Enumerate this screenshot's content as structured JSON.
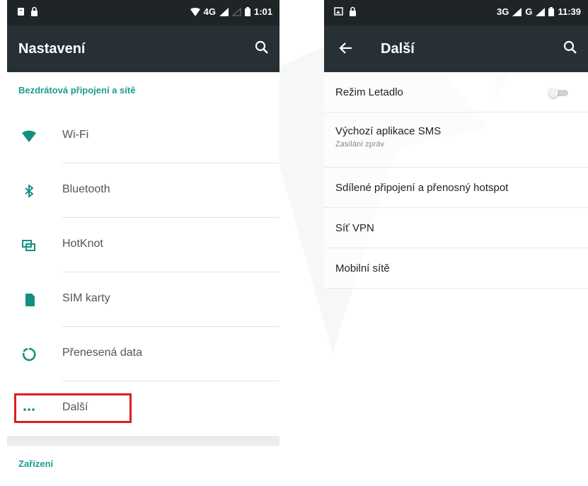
{
  "left_screen": {
    "status_bar": {
      "network": "4G",
      "time": "1:01"
    },
    "app_bar": {
      "title": "Nastavení"
    },
    "sections": [
      {
        "header": "Bezdrátová připojení a sítě",
        "items": [
          {
            "label": "Wi-Fi",
            "icon": "wifi-icon"
          },
          {
            "label": "Bluetooth",
            "icon": "bluetooth-icon"
          },
          {
            "label": "HotKnot",
            "icon": "hotknot-icon"
          },
          {
            "label": "SIM karty",
            "icon": "sim-card-icon"
          },
          {
            "label": "Přenesená data",
            "icon": "data-usage-icon"
          },
          {
            "label": "Další",
            "icon": "more-icon",
            "highlighted": true
          }
        ]
      },
      {
        "header": "Zařízení",
        "items": []
      }
    ],
    "highlight_color": "#e11c24",
    "accent_color": "#1a9e8f"
  },
  "right_screen": {
    "status_bar": {
      "network": "3G",
      "network2": "G",
      "time": "11:39"
    },
    "app_bar": {
      "title": "Další"
    },
    "items": [
      {
        "label": "Režim Letadlo",
        "toggle": "off"
      },
      {
        "label": "Výchozí aplikace SMS",
        "subtitle": "Zasílání zpráv"
      },
      {
        "label": "Sdílené připojení a přenosný hotspot"
      },
      {
        "label": "Síť VPN"
      },
      {
        "label": "Mobilní sítě"
      }
    ]
  }
}
